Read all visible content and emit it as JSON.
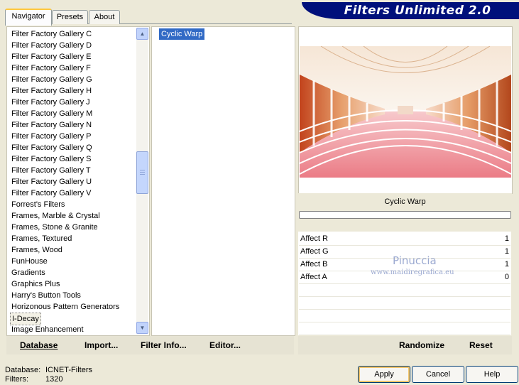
{
  "app": {
    "title": "Filters Unlimited 2.0"
  },
  "tabs": [
    {
      "label": "Navigator"
    },
    {
      "label": "Presets"
    },
    {
      "label": "About"
    }
  ],
  "categories": [
    "Filter Factory Gallery C",
    "Filter Factory Gallery D",
    "Filter Factory Gallery E",
    "Filter Factory Gallery F",
    "Filter Factory Gallery G",
    "Filter Factory Gallery H",
    "Filter Factory Gallery J",
    "Filter Factory Gallery M",
    "Filter Factory Gallery N",
    "Filter Factory Gallery P",
    "Filter Factory Gallery Q",
    "Filter Factory Gallery S",
    "Filter Factory Gallery T",
    "Filter Factory Gallery U",
    "Filter Factory Gallery V",
    "Forrest's Filters",
    "Frames, Marble & Crystal",
    "Frames, Stone & Granite",
    "Frames, Textured",
    "Frames, Wood",
    "FunHouse",
    "Gradients",
    "Graphics Plus",
    "Harry's Button Tools",
    "Horizonous Pattern Generators",
    "I-Decay",
    "Image Enhancement"
  ],
  "selected_category": "I-Decay",
  "filters": [
    "Cyclic Warp"
  ],
  "preview": {
    "filter_name": "Cyclic Warp"
  },
  "watermark": {
    "name": "Pinuccia",
    "url": "www.maidiregrafica.eu"
  },
  "params": [
    {
      "label": "Affect R",
      "value": "1"
    },
    {
      "label": "Affect G",
      "value": "1"
    },
    {
      "label": "Affect B",
      "value": "1"
    },
    {
      "label": "Affect A",
      "value": "0"
    }
  ],
  "toolbar": {
    "database": "Database",
    "import": "Import...",
    "filter_info": "Filter Info...",
    "editor": "Editor...",
    "randomize": "Randomize",
    "reset": "Reset"
  },
  "status": {
    "database_label": "Database:",
    "database_value": "ICNET-Filters",
    "filters_label": "Filters:",
    "filters_value": "1320"
  },
  "buttons": {
    "apply": "Apply",
    "cancel": "Cancel",
    "help": "Help"
  },
  "colors": {
    "banner": "#00107b",
    "selection": "#316ac5",
    "background": "#ece9d8"
  }
}
